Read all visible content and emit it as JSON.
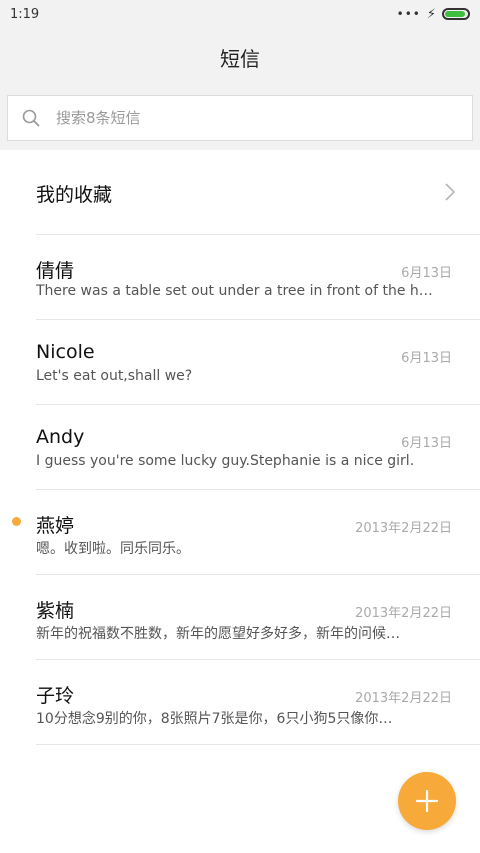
{
  "status": {
    "time": "1:19",
    "icons": [
      "more-dots-icon",
      "charging-icon",
      "battery-icon"
    ],
    "battery_level": 0.9
  },
  "header": {
    "title": "短信"
  },
  "search": {
    "placeholder": "搜索8条短信",
    "value": ""
  },
  "favorites": {
    "label": "我的收藏"
  },
  "messages": [
    {
      "name": "倩倩",
      "date": "6月13日",
      "preview": "There was a table set out under a tree in front of the hous",
      "unread": false
    },
    {
      "name": "Nicole",
      "date": "6月13日",
      "preview": "Let's eat out,shall we?",
      "unread": false
    },
    {
      "name": "Andy",
      "date": "6月13日",
      "preview": "I guess you're some lucky guy.Stephanie is a nice girl.",
      "unread": false
    },
    {
      "name": "燕婷",
      "date": "2013年2月22日",
      "preview": "嗯。收到啦。同乐同乐。",
      "unread": true
    },
    {
      "name": "紫楠",
      "date": "2013年2月22日",
      "preview": "新年的祝福数不胜数，新年的愿望好多好多，新年的问候…",
      "unread": false
    },
    {
      "name": "子玲",
      "date": "2013年2月22日",
      "preview": "10分想念9别的你，8张照片7张是你，6只小狗5只像你…",
      "unread": false
    }
  ],
  "colors": {
    "accent": "#f7a93a",
    "battery_fill": "#3fbf3f",
    "background_gray": "#f2f2f2"
  },
  "fab": {
    "icon": "plus-icon"
  }
}
